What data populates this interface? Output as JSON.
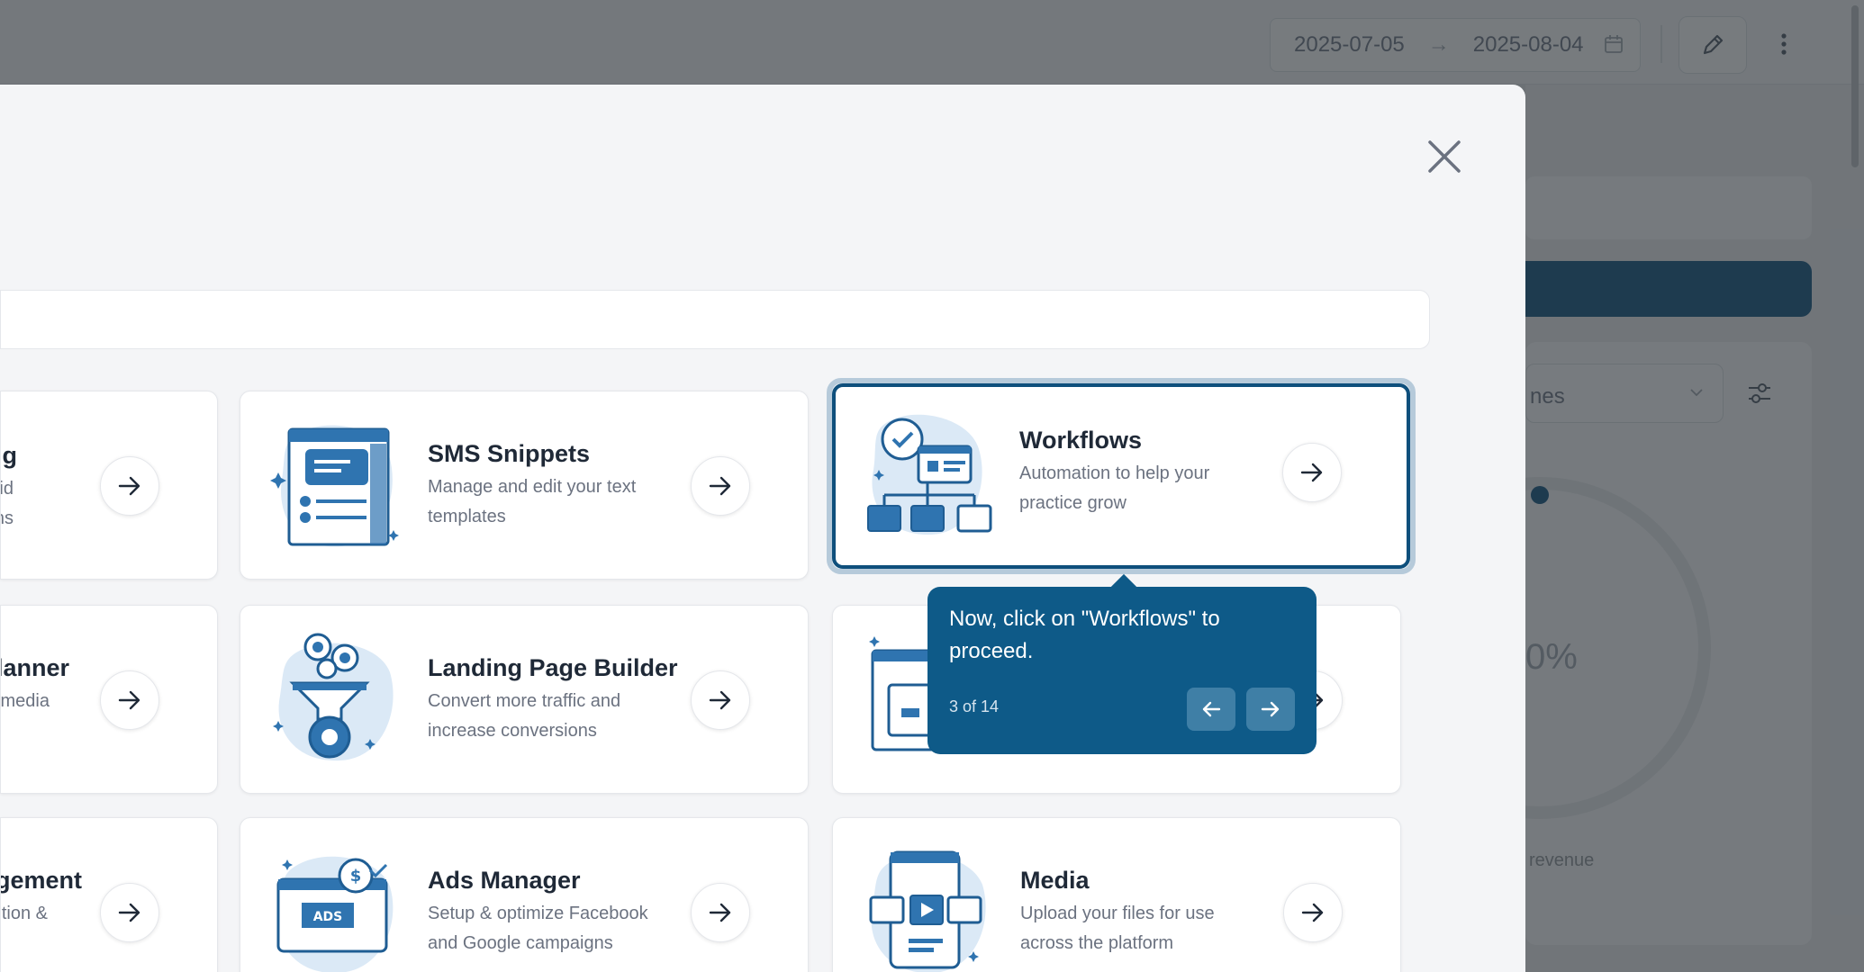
{
  "header": {
    "date_start": "2025-07-05",
    "date_end": "2025-08-04",
    "date_arrow": "→"
  },
  "background": {
    "select_value": "nes",
    "donut_value": "0%",
    "revenue_label": "revenue"
  },
  "cards": {
    "row1_left": {
      "title": "g",
      "desc_line1": "id",
      "desc_line2": "ns"
    },
    "sms_snippets": {
      "title": "SMS Snippets",
      "desc": "Manage and edit your text templates"
    },
    "workflows": {
      "title": "Workflows",
      "desc": "Automation to help your practice grow"
    },
    "row2_left": {
      "title": "lanner",
      "desc_line1": "media"
    },
    "landing_page_builder": {
      "title": "Landing Page Builder",
      "desc": "Convert more traffic and increase conversions"
    },
    "row3_left": {
      "title": "gement",
      "desc_line1": "tion &"
    },
    "ads_manager": {
      "title": "Ads Manager",
      "desc": "Setup & optimize Facebook and Google campaigns"
    },
    "media": {
      "title": "Media",
      "desc": "Upload your files for use across the platform"
    }
  },
  "tooltip": {
    "message": "Now, click on \"Workflows\" to proceed.",
    "step": "3 of 14"
  },
  "colors": {
    "brand_dark": "#0e4f7c",
    "tooltip_bg": "#0e5a88",
    "illustration_blue": "#2f74b0",
    "illustration_light": "#dbe9f6"
  },
  "icons": {
    "close": "close-icon",
    "arrow": "arrow-right-icon",
    "prev": "arrow-left-icon",
    "edit": "pencil-icon",
    "menu": "kebab-menu-icon",
    "calendar": "calendar-icon",
    "filter": "filter-icon"
  }
}
